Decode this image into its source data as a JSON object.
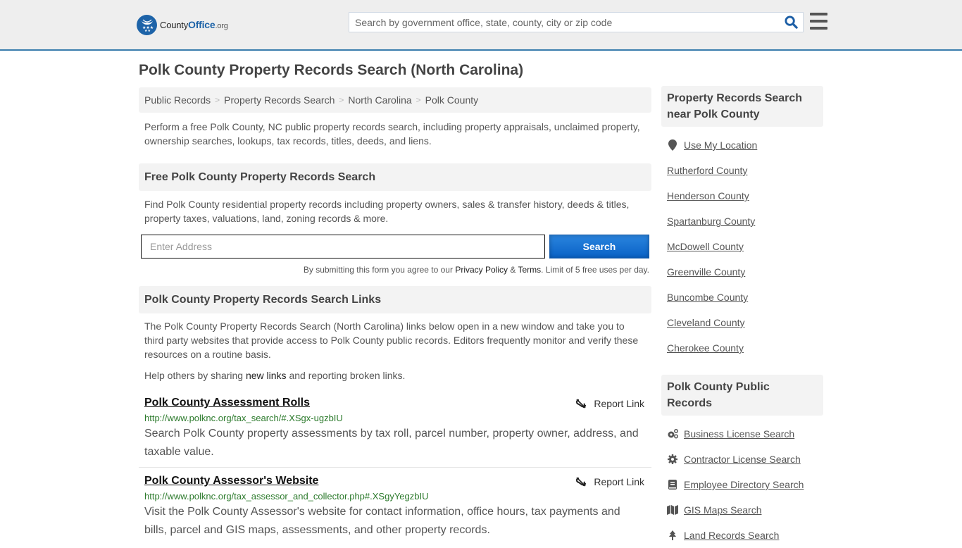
{
  "header": {
    "logo": {
      "county": "County",
      "office": "Office",
      "org": ".org"
    },
    "search_placeholder": "Search by government office, state, county, city or zip code"
  },
  "page_title": "Polk County Property Records Search (North Carolina)",
  "breadcrumb": [
    "Public Records",
    "Property Records Search",
    "North Carolina",
    "Polk County"
  ],
  "intro": "Perform a free Polk County, NC public property records search, including property appraisals, unclaimed property, ownership searches, lookups, tax records, titles, deeds, and liens.",
  "free_search": {
    "heading": "Free Polk County Property Records Search",
    "description": "Find Polk County residential property records including property owners, sales & transfer history, deeds & titles, property taxes, valuations, land, zoning records & more.",
    "address_placeholder": "Enter Address",
    "button_label": "Search",
    "legal_prefix": "By submitting this form you agree to our ",
    "privacy_label": "Privacy Policy",
    "amp": " & ",
    "terms_label": "Terms",
    "legal_suffix": ". Limit of 5 free uses per day."
  },
  "links_section": {
    "heading": "Polk County Property Records Search Links",
    "description": "The Polk County Property Records Search (North Carolina) links below open in a new window and take you to third party websites that provide access to Polk County public records. Editors frequently monitor and verify these resources on a routine basis.",
    "help_prefix": "Help others by sharing ",
    "help_link": "new links",
    "help_suffix": " and reporting broken links.",
    "report_label": "Report Link",
    "items": [
      {
        "title": "Polk County Assessment Rolls",
        "url": "http://www.polknc.org/tax_search/#.XSgx-ugzbIU",
        "description": "Search Polk County property assessments by tax roll, parcel number, property owner, address, and taxable value."
      },
      {
        "title": "Polk County Assessor's Website",
        "url": "http://www.polknc.org/tax_assessor_and_collector.php#.XSgyYegzbIU",
        "description": "Visit the Polk County Assessor's website for contact information, office hours, tax payments and bills, parcel and GIS maps, assessments, and other property records."
      }
    ]
  },
  "sidebar": {
    "nearby_heading": "Property Records Search near Polk County",
    "use_location": "Use My Location",
    "nearby": [
      "Rutherford County",
      "Henderson County",
      "Spartanburg County",
      "McDowell County",
      "Greenville County",
      "Buncombe County",
      "Cleveland County",
      "Cherokee County"
    ],
    "public_heading": "Polk County Public Records",
    "public_records": [
      {
        "label": "Business License Search",
        "icon": "cogs-icon"
      },
      {
        "label": "Contractor License Search",
        "icon": "gear-icon"
      },
      {
        "label": "Employee Directory Search",
        "icon": "book-icon"
      },
      {
        "label": "GIS Maps Search",
        "icon": "map-icon"
      },
      {
        "label": "Land Records Search",
        "icon": "tree-icon"
      }
    ]
  }
}
